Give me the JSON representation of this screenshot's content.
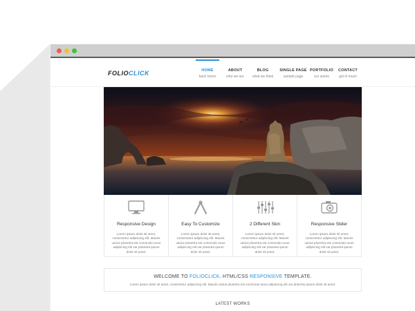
{
  "logo": {
    "part1": "FOLIO",
    "part2": "CLICK"
  },
  "nav": [
    {
      "title": "HOME",
      "sub": "back home",
      "active": true
    },
    {
      "title": "ABOUT",
      "sub": "who we are",
      "active": false
    },
    {
      "title": "BLOG",
      "sub": "what we think",
      "active": false
    },
    {
      "title": "SINGLE PAGE",
      "sub": "sample page",
      "active": false
    },
    {
      "title": "PORTFOLIO",
      "sub": "our works",
      "active": false
    },
    {
      "title": "CONTACT",
      "sub": "get in touch",
      "active": false
    }
  ],
  "features": [
    {
      "icon": "monitor-icon",
      "title": "Responsive Design",
      "text": "Lorem ipsum dolor sit amet, consectetur adipiscing elit. Mauris varius pharetra est commodo turus adipiscing elit var pharetra ipsum dolor sit amet."
    },
    {
      "icon": "tools-icon",
      "title": "Easy To Customize",
      "text": "Lorem ipsum dolor sit amet, consectetur adipiscing elit. Mauris varius pharetra est commodo turus adipiscing elit var pharetra ipsum dolor sit amet."
    },
    {
      "icon": "sliders-icon",
      "title": "2 Different Skin",
      "text": "Lorem ipsum dolor sit amet, consectetur adipiscing elit. Mauris varius pharetra est commodo turus adipiscing elit var pharetra ipsum dolor sit amet."
    },
    {
      "icon": "camera-icon",
      "title": "Responsive Slider",
      "text": "Lorem ipsum dolor sit amet, consectetur adipiscing elit. Mauris varius pharetra est commodo turus adipiscing elit var pharetra ipsum dolor sit amet."
    }
  ],
  "welcome": {
    "pre": "WELCOME TO ",
    "brand": "FOLIOCLICK",
    "mid": ". HTML/CSS ",
    "highlight": "RESPONSIVE",
    "post": " TEMPLATE.",
    "text": "Lorem ipsum dolor sit amet, consectetur adipiscing elit. Mauris varius pharetra est commodo turus adipiscing elit var pharetra ipsum dolor sit amet."
  },
  "latest_works": "LATEST WORKS",
  "colors": {
    "accent": "#2b8fd6",
    "titlebar": "#cfcfcf"
  }
}
